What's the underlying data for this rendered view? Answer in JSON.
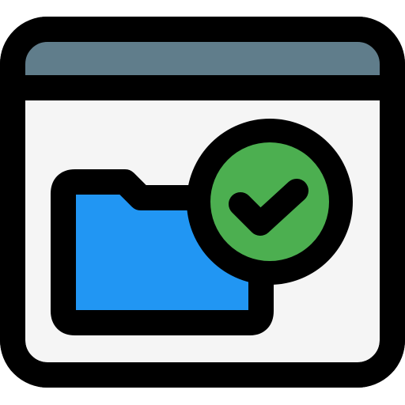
{
  "icon": {
    "name": "browser-window-folder-check-icon",
    "parts": [
      "window-frame-icon",
      "folder-icon",
      "check-circle-icon"
    ]
  },
  "colors": {
    "outline": "#000000",
    "window_body": "#f5f5f5",
    "title_bar": "#607d8b",
    "folder": "#2196f3",
    "check_circle": "#4caf50"
  }
}
